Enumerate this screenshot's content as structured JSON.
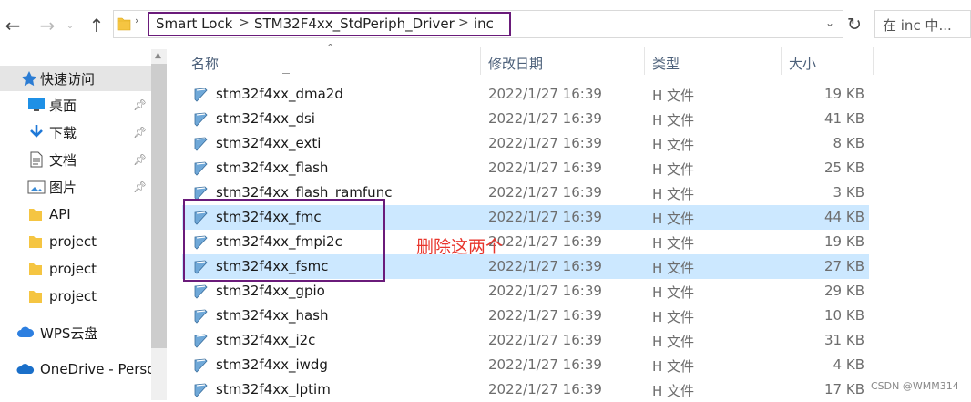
{
  "address_bar": {
    "crumbs": [
      "Smart Lock",
      "STM32F4xx_StdPeriph_Driver",
      "inc"
    ],
    "separator": ">",
    "search_placeholder": "在 inc 中..."
  },
  "nav": {
    "items": [
      {
        "label": "快速访问",
        "icon": "star-icon",
        "pinned": false,
        "selected": true
      },
      {
        "label": "桌面",
        "icon": "desktop-icon",
        "pinned": true
      },
      {
        "label": "下载",
        "icon": "download-icon",
        "pinned": true
      },
      {
        "label": "文档",
        "icon": "document-icon",
        "pinned": true
      },
      {
        "label": "图片",
        "icon": "picture-icon",
        "pinned": true
      },
      {
        "label": "API",
        "icon": "folder-icon",
        "pinned": false
      },
      {
        "label": "project",
        "icon": "folder-icon",
        "pinned": false
      },
      {
        "label": "project",
        "icon": "folder-icon",
        "pinned": false
      },
      {
        "label": "project",
        "icon": "folder-icon",
        "pinned": false
      },
      {
        "label": "WPS云盘",
        "icon": "cloud-icon",
        "pinned": false
      },
      {
        "label": "OneDrive - Perso",
        "icon": "onedrive-icon",
        "pinned": false
      }
    ]
  },
  "columns": {
    "name": "名称",
    "date": "修改日期",
    "type": "类型",
    "size": "大小"
  },
  "files": [
    {
      "name": "stm32f4xx_dma2d",
      "date": "2022/1/27 16:39",
      "type": "H 文件",
      "size": "19 KB",
      "selected": false
    },
    {
      "name": "stm32f4xx_dsi",
      "date": "2022/1/27 16:39",
      "type": "H 文件",
      "size": "41 KB",
      "selected": false
    },
    {
      "name": "stm32f4xx_exti",
      "date": "2022/1/27 16:39",
      "type": "H 文件",
      "size": "8 KB",
      "selected": false
    },
    {
      "name": "stm32f4xx_flash",
      "date": "2022/1/27 16:39",
      "type": "H 文件",
      "size": "25 KB",
      "selected": false
    },
    {
      "name": "stm32f4xx_flash_ramfunc",
      "date": "2022/1/27 16:39",
      "type": "H 文件",
      "size": "3 KB",
      "selected": false
    },
    {
      "name": "stm32f4xx_fmc",
      "date": "2022/1/27 16:39",
      "type": "H 文件",
      "size": "44 KB",
      "selected": true
    },
    {
      "name": "stm32f4xx_fmpi2c",
      "date": "2022/1/27 16:39",
      "type": "H 文件",
      "size": "19 KB",
      "selected": false
    },
    {
      "name": "stm32f4xx_fsmc",
      "date": "2022/1/27 16:39",
      "type": "H 文件",
      "size": "27 KB",
      "selected": true
    },
    {
      "name": "stm32f4xx_gpio",
      "date": "2022/1/27 16:39",
      "type": "H 文件",
      "size": "29 KB",
      "selected": false
    },
    {
      "name": "stm32f4xx_hash",
      "date": "2022/1/27 16:39",
      "type": "H 文件",
      "size": "10 KB",
      "selected": false
    },
    {
      "name": "stm32f4xx_i2c",
      "date": "2022/1/27 16:39",
      "type": "H 文件",
      "size": "31 KB",
      "selected": false
    },
    {
      "name": "stm32f4xx_iwdg",
      "date": "2022/1/27 16:39",
      "type": "H 文件",
      "size": "4 KB",
      "selected": false
    },
    {
      "name": "stm32f4xx_lptim",
      "date": "2022/1/27 16:39",
      "type": "H 文件",
      "size": "17 KB",
      "selected": false
    }
  ],
  "annotation": "删除这两个",
  "watermark": "CSDN @WMM314",
  "colors": {
    "highlight_box": "#6a1b7a",
    "annotation_text": "#e8352c",
    "selected_row": "#cce8ff"
  }
}
